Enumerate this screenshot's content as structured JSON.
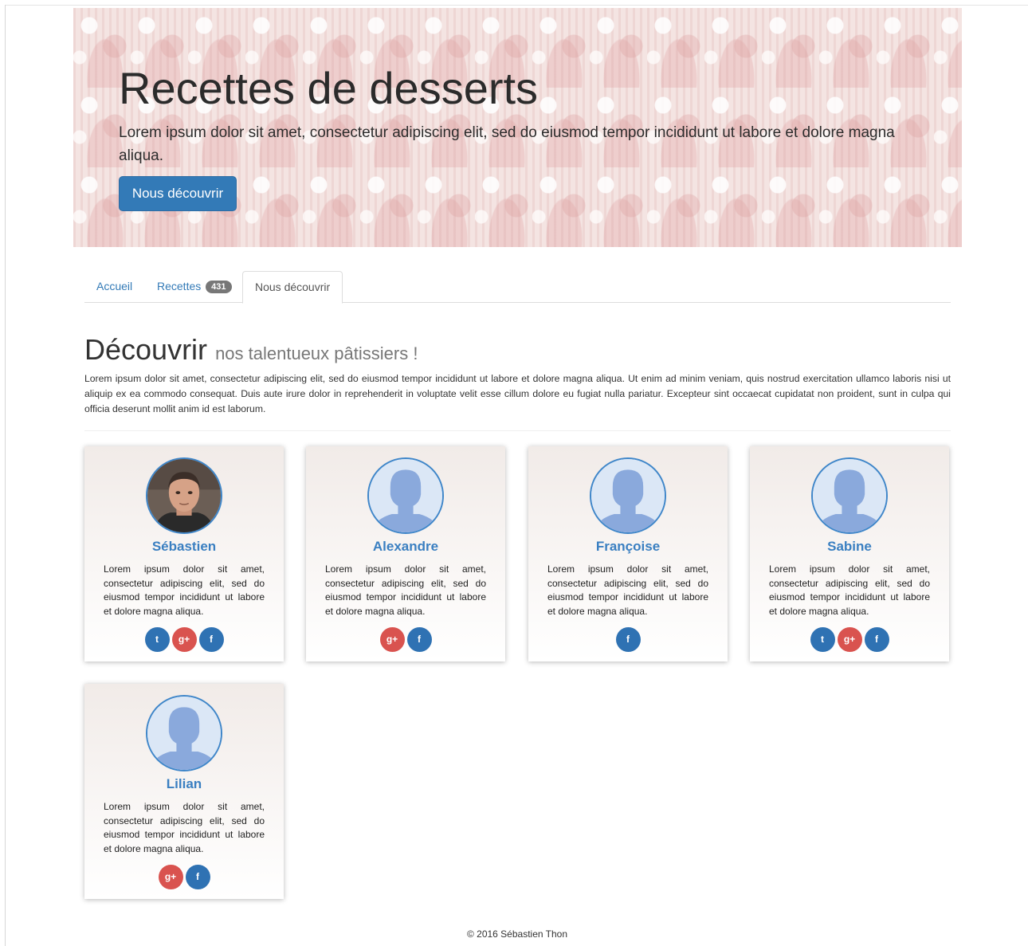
{
  "hero": {
    "title": "Recettes de desserts",
    "text": "Lorem ipsum dolor sit amet, consectetur adipiscing elit, sed do eiusmod tempor incididunt ut labore et dolore magna aliqua.",
    "button": "Nous découvrir"
  },
  "tabs": [
    {
      "label": "Accueil",
      "active": false
    },
    {
      "label": "Recettes",
      "badge": "431",
      "active": false
    },
    {
      "label": "Nous découvrir",
      "active": true
    }
  ],
  "section": {
    "title": "Découvrir",
    "subtitle": "nos talentueux pâtissiers !",
    "text": "Lorem ipsum dolor sit amet, consectetur adipiscing elit, sed do eiusmod tempor incididunt ut labore et dolore magna aliqua. Ut enim ad minim veniam, quis nostrud exercitation ullamco laboris nisi ut aliquip ex ea commodo consequat. Duis aute irure dolor in reprehenderit in voluptate velit esse cillum dolore eu fugiat nulla pariatur. Excepteur sint occaecat cupidatat non proident, sunt in culpa qui officia deserunt mollit anim id est laborum."
  },
  "cards": [
    {
      "name": "Sébastien",
      "avatar": "photo",
      "text": "Lorem ipsum dolor sit amet, consectetur adipiscing elit, sed do eiusmod tempor incididunt ut labore et dolore magna aliqua.",
      "socials": [
        "twitter",
        "google-plus",
        "facebook"
      ]
    },
    {
      "name": "Alexandre",
      "avatar": "placeholder",
      "text": "Lorem ipsum dolor sit amet, consectetur adipiscing elit, sed do eiusmod tempor incididunt ut labore et dolore magna aliqua.",
      "socials": [
        "google-plus",
        "facebook"
      ]
    },
    {
      "name": "Françoise",
      "avatar": "placeholder",
      "text": "Lorem ipsum dolor sit amet, consectetur adipiscing elit, sed do eiusmod tempor incididunt ut labore et dolore magna aliqua.",
      "socials": [
        "facebook"
      ]
    },
    {
      "name": "Sabine",
      "avatar": "placeholder",
      "text": "Lorem ipsum dolor sit amet, consectetur adipiscing elit, sed do eiusmod tempor incididunt ut labore et dolore magna aliqua.",
      "socials": [
        "twitter",
        "google-plus",
        "facebook"
      ]
    },
    {
      "name": "Lilian",
      "avatar": "placeholder",
      "text": "Lorem ipsum dolor sit amet, consectetur adipiscing elit, sed do eiusmod tempor incididunt ut labore et dolore magna aliqua.",
      "socials": [
        "google-plus",
        "facebook"
      ]
    }
  ],
  "social_glyphs": {
    "twitter": "t",
    "google-plus": "g+",
    "facebook": "f"
  },
  "footer": "© 2016 Sébastien Thon",
  "colors": {
    "primary": "#337ab7",
    "google": "#d9534f",
    "name": "#3a7fc1"
  }
}
